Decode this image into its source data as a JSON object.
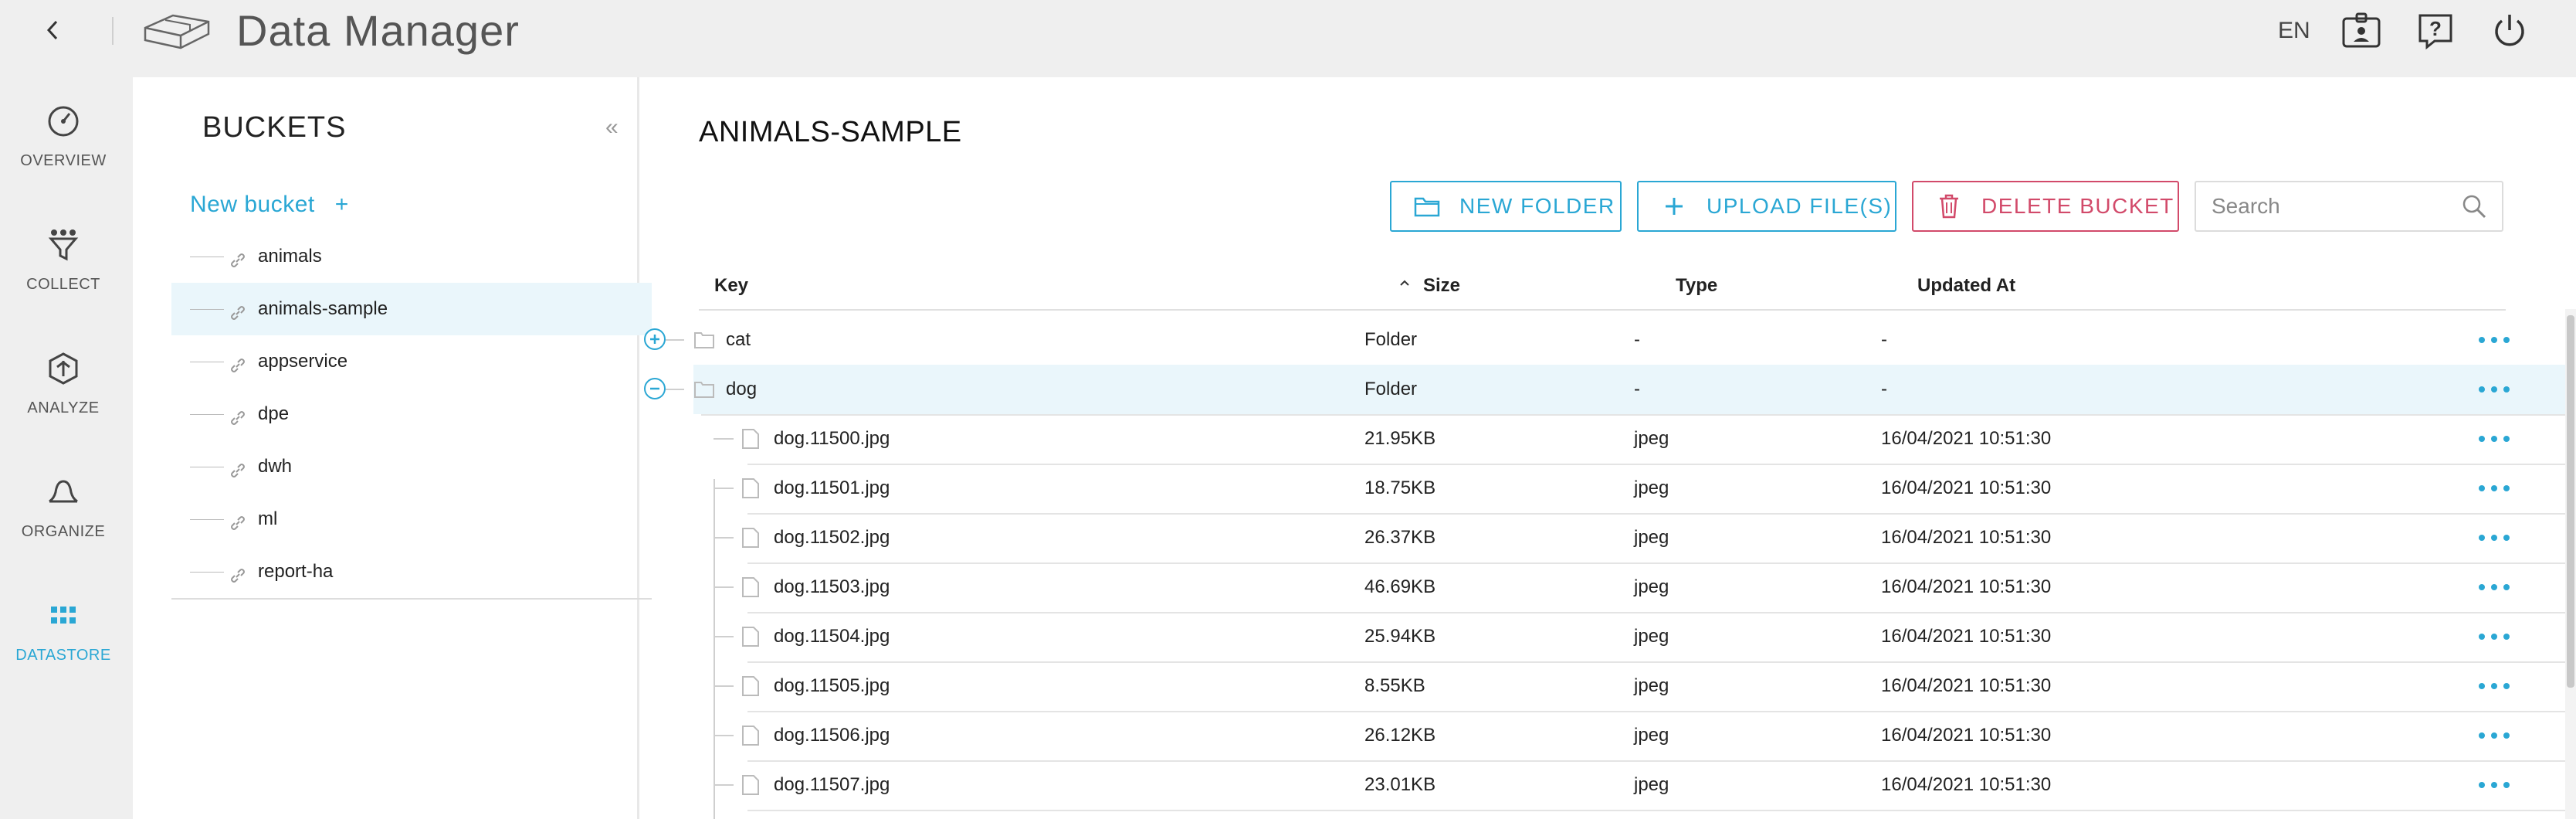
{
  "app": {
    "title": "Data Manager",
    "lang": "EN"
  },
  "icons": {
    "back": "chevron-left-icon",
    "logo": "storage-boxes-icon",
    "badge": "id-badge-icon",
    "help": "help-icon",
    "power": "power-icon"
  },
  "colors": {
    "accent": "#2aa7d4",
    "danger": "#d24a6a",
    "selected_row": "#eaf6fb"
  },
  "nav": [
    {
      "label": "OVERVIEW",
      "icon": "gauge-icon",
      "active": false
    },
    {
      "label": "COLLECT",
      "icon": "funnel-icon",
      "active": false
    },
    {
      "label": "ANALYZE",
      "icon": "analyze-icon",
      "active": false
    },
    {
      "label": "ORGANIZE",
      "icon": "organize-icon",
      "active": false
    },
    {
      "label": "DATASTORE",
      "icon": "grid-icon",
      "active": true
    }
  ],
  "buckets": {
    "title": "BUCKETS",
    "collapse": "«",
    "new_label": "New bucket",
    "new_plus": "+",
    "items": [
      {
        "name": "animals",
        "selected": false
      },
      {
        "name": "animals-sample",
        "selected": true
      },
      {
        "name": "appservice",
        "selected": false
      },
      {
        "name": "dpe",
        "selected": false
      },
      {
        "name": "dwh",
        "selected": false
      },
      {
        "name": "ml",
        "selected": false
      },
      {
        "name": "report-ha",
        "selected": false
      }
    ]
  },
  "content": {
    "title": "ANIMALS-SAMPLE",
    "new_folder": "NEW FOLDER",
    "upload": "UPLOAD FILE(S)",
    "delete_bucket": "DELETE BUCKET",
    "search_placeholder": "Search"
  },
  "table": {
    "headers": {
      "key": "Key",
      "size": "Size",
      "type": "Type",
      "updated": "Updated At"
    },
    "folders": [
      {
        "key": "cat",
        "size": "Folder",
        "type": "-",
        "updated": "-",
        "expanded": false
      },
      {
        "key": "dog",
        "size": "Folder",
        "type": "-",
        "updated": "-",
        "expanded": true
      }
    ],
    "files": [
      {
        "key": "dog.11500.jpg",
        "size": "21.95KB",
        "type": "jpeg",
        "updated": "16/04/2021 10:51:30"
      },
      {
        "key": "dog.11501.jpg",
        "size": "18.75KB",
        "type": "jpeg",
        "updated": "16/04/2021 10:51:30"
      },
      {
        "key": "dog.11502.jpg",
        "size": "26.37KB",
        "type": "jpeg",
        "updated": "16/04/2021 10:51:30"
      },
      {
        "key": "dog.11503.jpg",
        "size": "46.69KB",
        "type": "jpeg",
        "updated": "16/04/2021 10:51:30"
      },
      {
        "key": "dog.11504.jpg",
        "size": "25.94KB",
        "type": "jpeg",
        "updated": "16/04/2021 10:51:30"
      },
      {
        "key": "dog.11505.jpg",
        "size": "8.55KB",
        "type": "jpeg",
        "updated": "16/04/2021 10:51:30"
      },
      {
        "key": "dog.11506.jpg",
        "size": "26.12KB",
        "type": "jpeg",
        "updated": "16/04/2021 10:51:30"
      },
      {
        "key": "dog.11507.jpg",
        "size": "23.01KB",
        "type": "jpeg",
        "updated": "16/04/2021 10:51:30"
      }
    ]
  }
}
